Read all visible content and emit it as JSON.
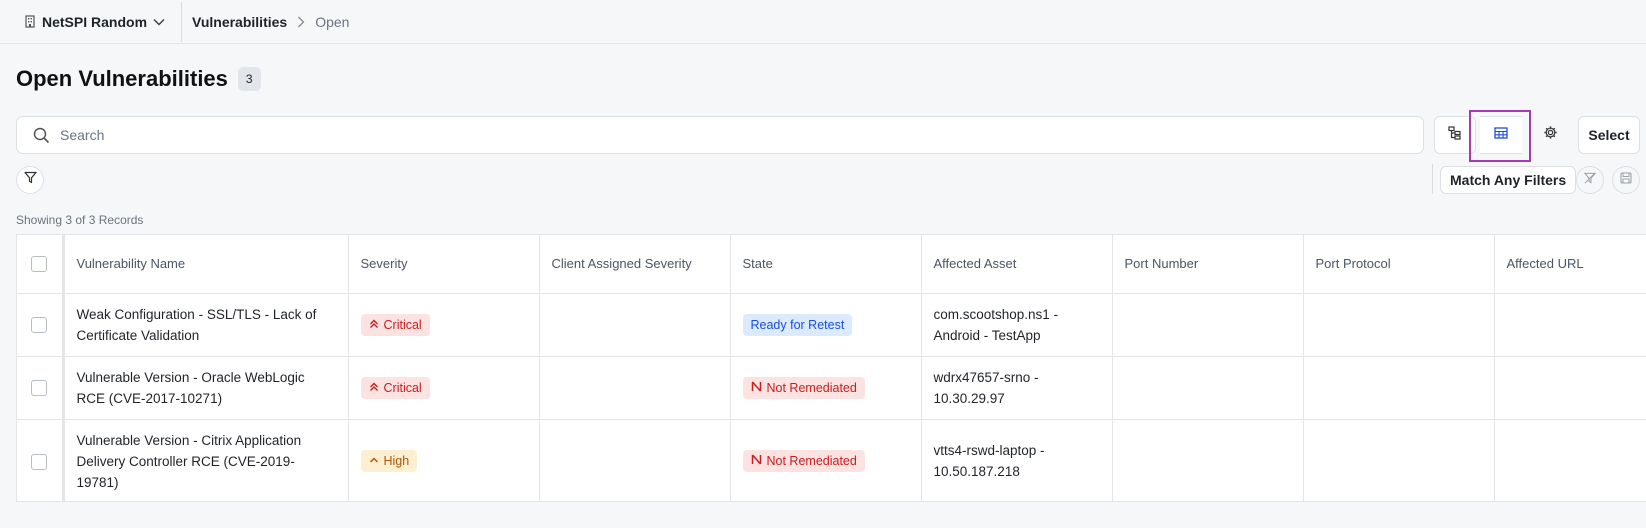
{
  "topbar": {
    "org_name": "NetSPI Random",
    "breadcrumb": [
      "Vulnerabilities",
      "Open"
    ]
  },
  "page": {
    "title": "Open Vulnerabilities",
    "count": "3"
  },
  "search": {
    "placeholder": "Search"
  },
  "toolbar": {
    "select_label": "Select",
    "match_filters_label": "Match Any Filters",
    "active_view": "table",
    "highlight_color": "#a43bb0"
  },
  "records_text": "Showing 3 of 3 Records",
  "table": {
    "columns": [
      "Vulnerability Name",
      "Severity",
      "Client Assigned Severity",
      "State",
      "Affected Asset",
      "Port Number",
      "Port Protocol",
      "Affected URL"
    ],
    "rows": [
      {
        "name": "Weak Configuration - SSL/TLS - Lack of Certificate Validation",
        "severity": "Critical",
        "client_severity": "",
        "state": "Ready for Retest",
        "asset": "com.scootshop.ns1 - Android - TestApp",
        "port_number": "",
        "port_protocol": "",
        "affected_url": ""
      },
      {
        "name": "Vulnerable Version - Oracle WebLogic RCE (CVE-2017-10271)",
        "severity": "Critical",
        "client_severity": "",
        "state": "Not Remediated",
        "asset": "wdrx47657-srno - 10.30.29.97",
        "port_number": "",
        "port_protocol": "",
        "affected_url": ""
      },
      {
        "name": "Vulnerable Version - Citrix Application Delivery Controller RCE (CVE-2019-19781)",
        "severity": "High",
        "client_severity": "",
        "state": "Not Remediated",
        "asset": "vtts4-rswd-laptop - 10.50.187.218",
        "port_number": "",
        "port_protocol": "",
        "affected_url": ""
      }
    ]
  }
}
